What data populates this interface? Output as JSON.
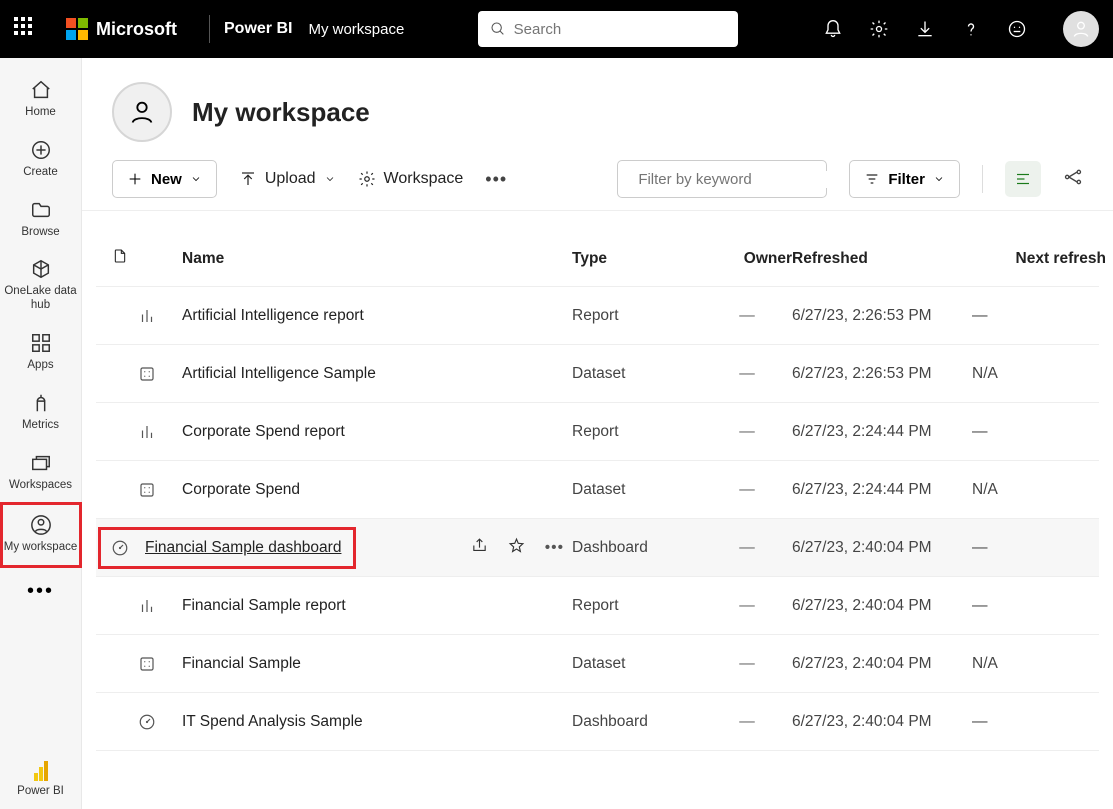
{
  "header": {
    "ms_text": "Microsoft",
    "brand": "Power BI",
    "workspace": "My workspace",
    "search_placeholder": "Search"
  },
  "nav": {
    "items": [
      {
        "label": "Home"
      },
      {
        "label": "Create"
      },
      {
        "label": "Browse"
      },
      {
        "label": "OneLake data hub"
      },
      {
        "label": "Apps"
      },
      {
        "label": "Metrics"
      },
      {
        "label": "Workspaces"
      },
      {
        "label": "My workspace"
      }
    ],
    "footer": "Power BI"
  },
  "workspace": {
    "title": "My workspace",
    "new_label": "New",
    "upload_label": "Upload",
    "settings_label": "Workspace",
    "filter_placeholder": "Filter by keyword",
    "filter_button": "Filter"
  },
  "columns": {
    "name": "Name",
    "type": "Type",
    "owner": "Owner",
    "refreshed": "Refreshed",
    "next": "Next refresh"
  },
  "rows": [
    {
      "icon": "report",
      "name": "Artificial Intelligence report",
      "type": "Report",
      "owner": "—",
      "refreshed": "6/27/23, 2:26:53 PM",
      "next": "—"
    },
    {
      "icon": "dataset",
      "name": "Artificial Intelligence Sample",
      "type": "Dataset",
      "owner": "—",
      "refreshed": "6/27/23, 2:26:53 PM",
      "next": "N/A"
    },
    {
      "icon": "report",
      "name": "Corporate Spend report",
      "type": "Report",
      "owner": "—",
      "refreshed": "6/27/23, 2:24:44 PM",
      "next": "—"
    },
    {
      "icon": "dataset",
      "name": "Corporate Spend",
      "type": "Dataset",
      "owner": "—",
      "refreshed": "6/27/23, 2:24:44 PM",
      "next": "N/A"
    },
    {
      "icon": "dashboard",
      "name": "Financial Sample dashboard",
      "type": "Dashboard",
      "owner": "—",
      "refreshed": "6/27/23, 2:40:04 PM",
      "next": "—",
      "selected": true
    },
    {
      "icon": "report",
      "name": "Financial Sample report",
      "type": "Report",
      "owner": "—",
      "refreshed": "6/27/23, 2:40:04 PM",
      "next": "—"
    },
    {
      "icon": "dataset",
      "name": "Financial Sample",
      "type": "Dataset",
      "owner": "—",
      "refreshed": "6/27/23, 2:40:04 PM",
      "next": "N/A"
    },
    {
      "icon": "dashboard",
      "name": "IT Spend Analysis Sample",
      "type": "Dashboard",
      "owner": "—",
      "refreshed": "6/27/23, 2:40:04 PM",
      "next": "—"
    }
  ]
}
